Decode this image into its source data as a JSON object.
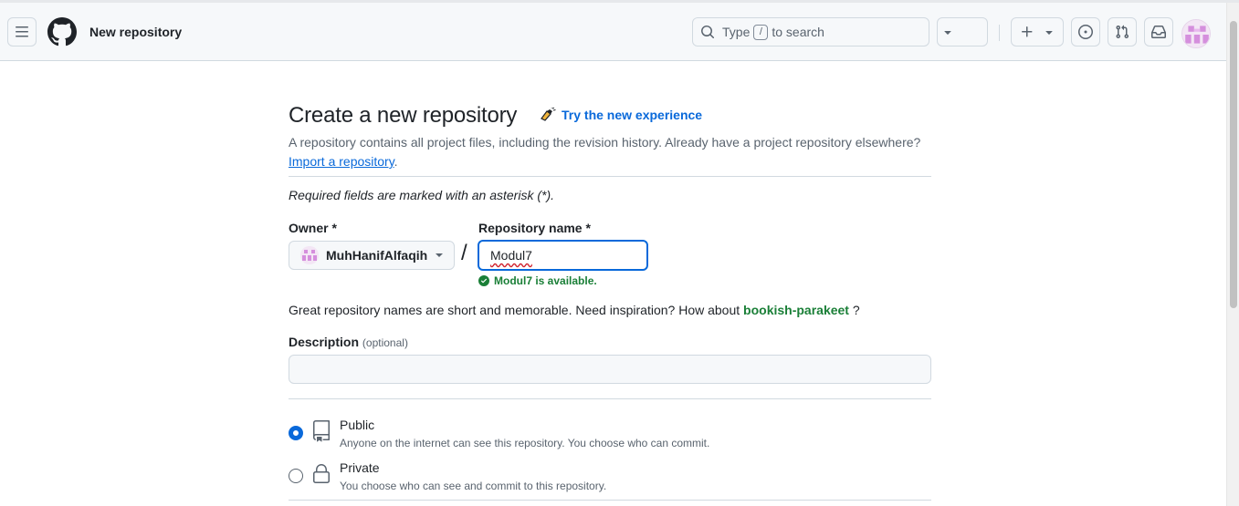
{
  "header": {
    "title": "New repository",
    "search": {
      "prefix": "Type",
      "key": "/",
      "suffix": "to search"
    }
  },
  "form": {
    "heading": "Create a new repository",
    "try_new": "Try the new experience",
    "intro_text": "A repository contains all project files, including the revision history. Already have a project repository elsewhere?",
    "import_link": "Import a repository",
    "intro_period": ".",
    "required_note": "Required fields are marked with an asterisk (*).",
    "owner_label": "Owner *",
    "owner_value": "MuhHanifAlfaqih",
    "slash": "/",
    "repo_label": "Repository name *",
    "repo_value": "Modul7",
    "available_msg": "Modul7 is available.",
    "inspire_text": "Great repository names are short and memorable. Need inspiration? How about",
    "suggestion": "bookish-parakeet",
    "inspire_end": "?",
    "description_label": "Description",
    "description_optional": "(optional)",
    "description_value": ""
  },
  "visibility": [
    {
      "title": "Public",
      "desc": "Anyone on the internet can see this repository. You choose who can commit.",
      "selected": true,
      "icon": "repo-icon"
    },
    {
      "title": "Private",
      "desc": "You choose who can see and commit to this repository.",
      "selected": false,
      "icon": "lock-icon"
    }
  ],
  "colors": {
    "accent": "#0969da",
    "success": "#1a7f37",
    "border": "#d1d9e0",
    "header_bg": "#f6f8fa"
  }
}
